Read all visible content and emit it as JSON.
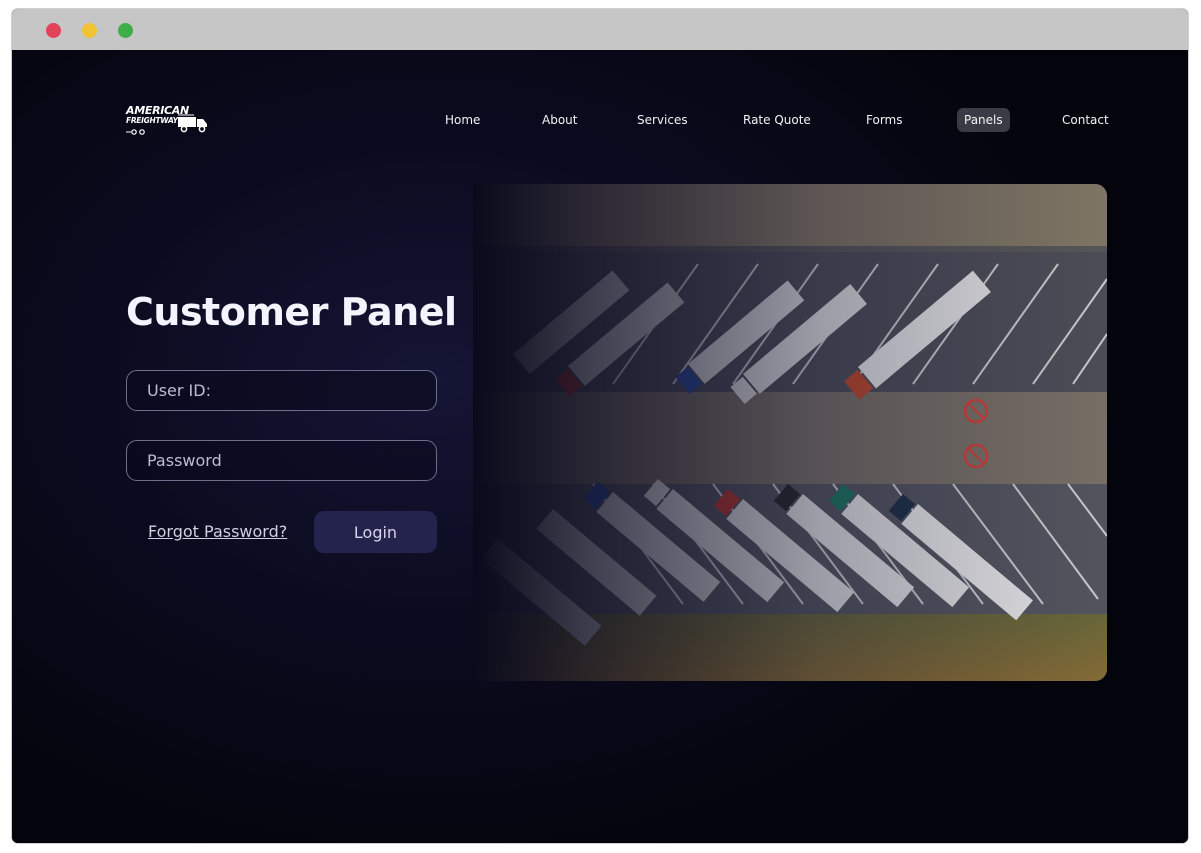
{
  "brand": {
    "line1": "AMERICAN",
    "line2": "FREIGHTWAYS"
  },
  "nav": {
    "items": [
      {
        "label": "Home"
      },
      {
        "label": "About"
      },
      {
        "label": "Services"
      },
      {
        "label": "Rate Quote"
      },
      {
        "label": "Forms"
      },
      {
        "label": "Panels",
        "active": true
      },
      {
        "label": "Contact"
      }
    ]
  },
  "panel": {
    "title": "Customer Panel",
    "user_placeholder": "User ID:",
    "password_placeholder": "Password",
    "forgot_label": "Forgot Password?",
    "login_label": "Login"
  },
  "colors": {
    "background": "#05050f",
    "accent_button": "#23234d",
    "active_nav": "#3b3b45",
    "traffic_red": "#e2435a",
    "traffic_yellow": "#f1c232",
    "traffic_green": "#3fae49"
  }
}
